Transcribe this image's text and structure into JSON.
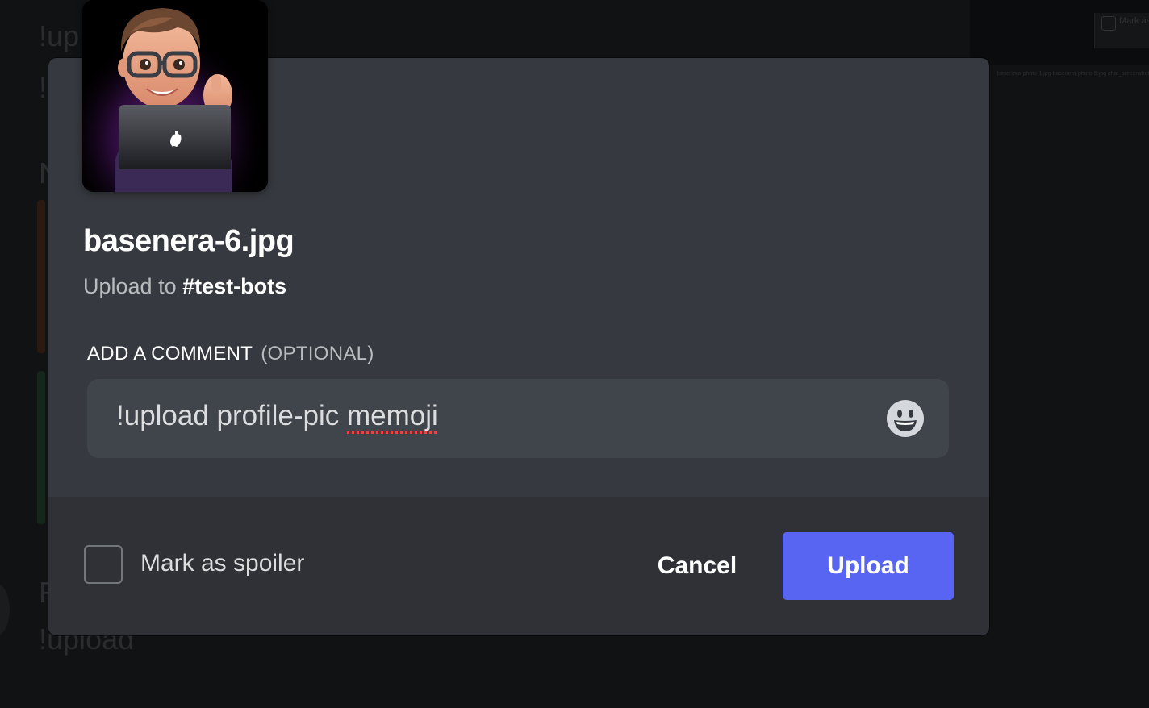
{
  "background": {
    "lines": [
      "!up",
      "!",
      "N",
      "R",
      "!upload"
    ],
    "corner_label": "Mark as",
    "tabs_text": "basenera-photo-1.jpg  basenera-photo-5.jpg  chat_screenshot.png"
  },
  "modal": {
    "thumbnail": "memoji-profile-image",
    "filename": "basenera-6.jpg",
    "upload_to_prefix": "Upload to",
    "channel": "#test-bots",
    "comment_label": "ADD A COMMENT",
    "comment_optional": "(OPTIONAL)",
    "comment_value_plain": "!upload profile-pic ",
    "comment_value_misspelled": "memoji",
    "emoji_icon": "grinning-face-icon",
    "spoiler_label": "Mark as spoiler",
    "spoiler_checked": false,
    "cancel_label": "Cancel",
    "upload_label": "Upload"
  },
  "colors": {
    "modal_bg": "#36393f",
    "footer_bg": "#2f3136",
    "input_bg": "#40444b",
    "primary": "#5865f2"
  }
}
